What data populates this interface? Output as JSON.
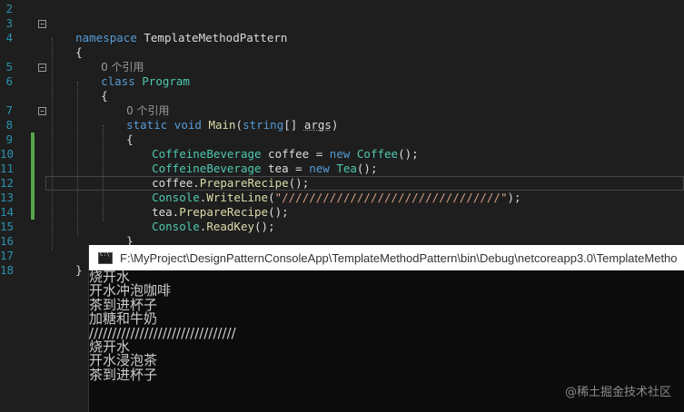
{
  "editor": {
    "lines": [
      {
        "num": "2"
      },
      {
        "num": "3"
      },
      {
        "num": "4"
      },
      {
        "num": "5"
      },
      {
        "num": "6"
      },
      {
        "num": "7"
      },
      {
        "num": "8"
      },
      {
        "num": "9"
      },
      {
        "num": "10"
      },
      {
        "num": "11"
      },
      {
        "num": "12"
      },
      {
        "num": "13"
      },
      {
        "num": "14"
      },
      {
        "num": "15"
      },
      {
        "num": "16"
      },
      {
        "num": "17"
      },
      {
        "num": "18"
      }
    ],
    "code": {
      "l3_kw": "namespace",
      "l3_name": " TemplateMethodPattern",
      "brace_open": "{",
      "brace_close": "}",
      "codelens_refs": "0 个引用",
      "l5_kw": "class",
      "l5_name": "Program",
      "l7_kw1": "static",
      "l7_kw2": "void",
      "l7_fn": "Main",
      "l7_paren_open": "(",
      "l7_kw3": "string",
      "l7_brackets": "[] ",
      "l7_args": "args",
      "l7_paren_close": ")",
      "l9_type": "CoffeineBeverage",
      "l9_var": " coffee = ",
      "l9_new": "new",
      "l9_ctor": "Coffee",
      "l9_end": "();",
      "l10_type": "CoffeineBeverage",
      "l10_var": " tea = ",
      "l10_new": "new",
      "l10_ctor": "Tea",
      "l10_end": "();",
      "l11_obj": "coffee.",
      "l11_fn": "PrepareRecipe",
      "l11_end": "();",
      "l12_cls": "Console",
      "l12_dot": ".",
      "l12_fn": "WriteLine",
      "l12_open": "(",
      "l12_str": "\"////////////////////////////////\"",
      "l12_end": ");",
      "l13_obj": "tea.",
      "l13_fn": "PrepareRecipe",
      "l13_end": "();",
      "l14_cls": "Console",
      "l14_dot": ".",
      "l14_fn": "ReadKey",
      "l14_end": "();"
    }
  },
  "console": {
    "title": "F:\\MyProject\\DesignPatternConsoleApp\\TemplateMethodPattern\\bin\\Debug\\netcoreapp3.0\\TemplateMetho",
    "output": [
      "烧开水",
      "开水冲泡咖啡",
      "茶到进杯子",
      "加糖和牛奶",
      "////////////////////////////////",
      "烧开水",
      "开水浸泡茶",
      "茶到进杯子"
    ]
  },
  "watermark": "@稀土掘金技术社区",
  "colors": {
    "background": "#1e1e1e",
    "keyword": "#569cd6",
    "type": "#4ec9b0",
    "string": "#d69d85",
    "line_number": "#2b91af",
    "change_bar": "#57a64a",
    "console_bg": "#0c0c0c"
  },
  "icons": [
    "console-app-icon",
    "fold-toggle-icon"
  ]
}
